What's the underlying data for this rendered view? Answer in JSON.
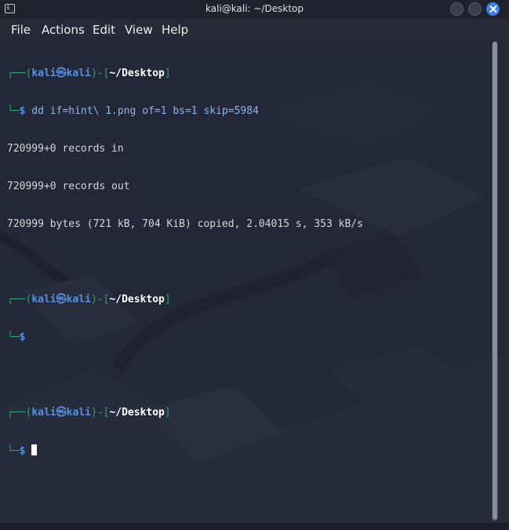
{
  "window": {
    "title": "kali@kali: ~/Desktop",
    "icon": "terminal-icon",
    "icon_glyph": "$_",
    "buttons": [
      "minimize-button",
      "maximize-button",
      "close-button"
    ]
  },
  "menu": [
    "File",
    "Actions",
    "Edit",
    "View",
    "Help"
  ],
  "prompt": {
    "open": "┌──(",
    "user": "kali",
    "at": "㉿",
    "host": "kali",
    "close": ")-[",
    "path": "~/Desktop",
    "end": "]",
    "second_line": "└─",
    "symbol": "$"
  },
  "terminal_output": {
    "command": " dd if=hint\\ 1.png of=1 bs=1 skip=5984",
    "lines": [
      "720999+0 records in",
      "720999+0 records out",
      "720999 bytes (721 kB, 704 KiB) copied, 2.04015 s, 353 kB/s"
    ]
  },
  "colors": {
    "background": "#232838",
    "prompt_green": "#2ea36d",
    "prompt_blue": "#5a8fe0",
    "close_button": "#3d80e0"
  }
}
